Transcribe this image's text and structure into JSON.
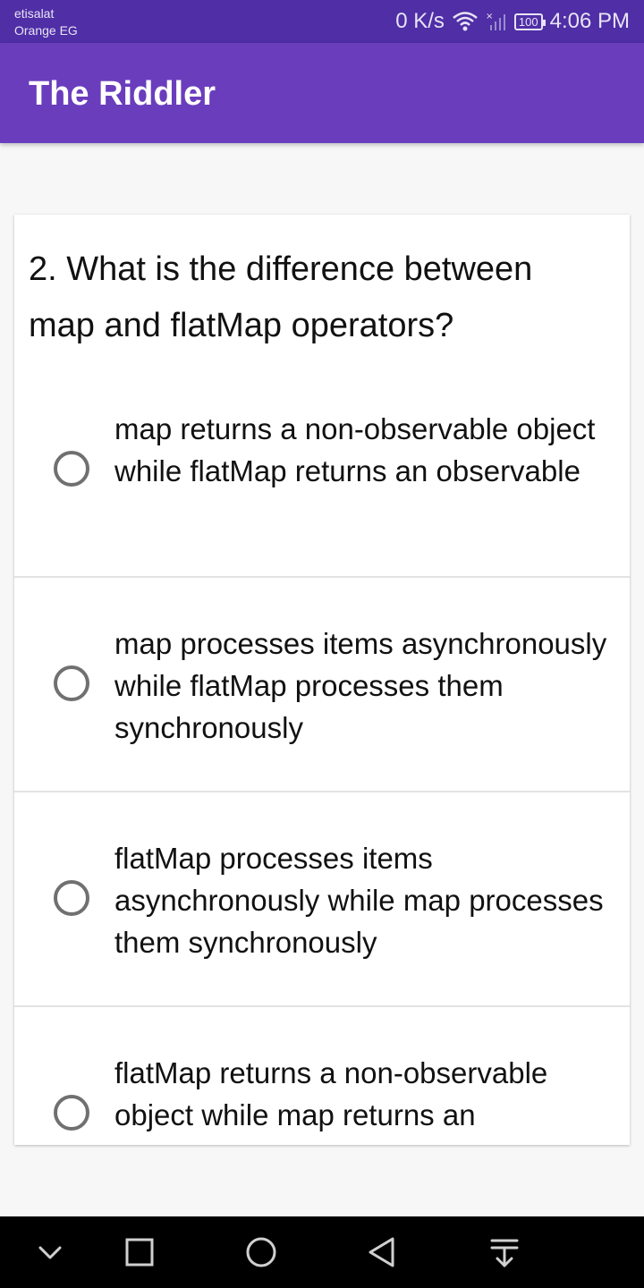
{
  "status_bar": {
    "carrier_line1": "etisalat",
    "carrier_line2": "Orange EG",
    "speed": "0 K/s",
    "battery": "100",
    "time": "4:06 PM",
    "icons": [
      "wifi-icon",
      "signal-icon",
      "battery-icon"
    ]
  },
  "app_bar": {
    "title": "The Riddler"
  },
  "question": {
    "text": "2. What is the difference between map and flatMap operators?"
  },
  "options": [
    {
      "label": "map returns a non-observable object while flatMap returns an observable",
      "selected": false
    },
    {
      "label": "map processes items asynchronously while flatMap processes them synchronously",
      "selected": false
    },
    {
      "label": "flatMap processes items asynchronously while map processes them synchronously",
      "selected": false
    },
    {
      "label": "flatMap returns a non-observable object while map returns an observable",
      "selected": false
    }
  ],
  "nav_bar": {
    "icons": [
      "hide-nav-icon",
      "recents-icon",
      "home-icon",
      "back-icon",
      "notifications-pull-icon"
    ]
  },
  "colors": {
    "status_bar": "#4f2ea6",
    "app_bar": "#6a3dbd",
    "background": "#f7f7f7",
    "card": "#ffffff",
    "radio_border": "#707070"
  }
}
